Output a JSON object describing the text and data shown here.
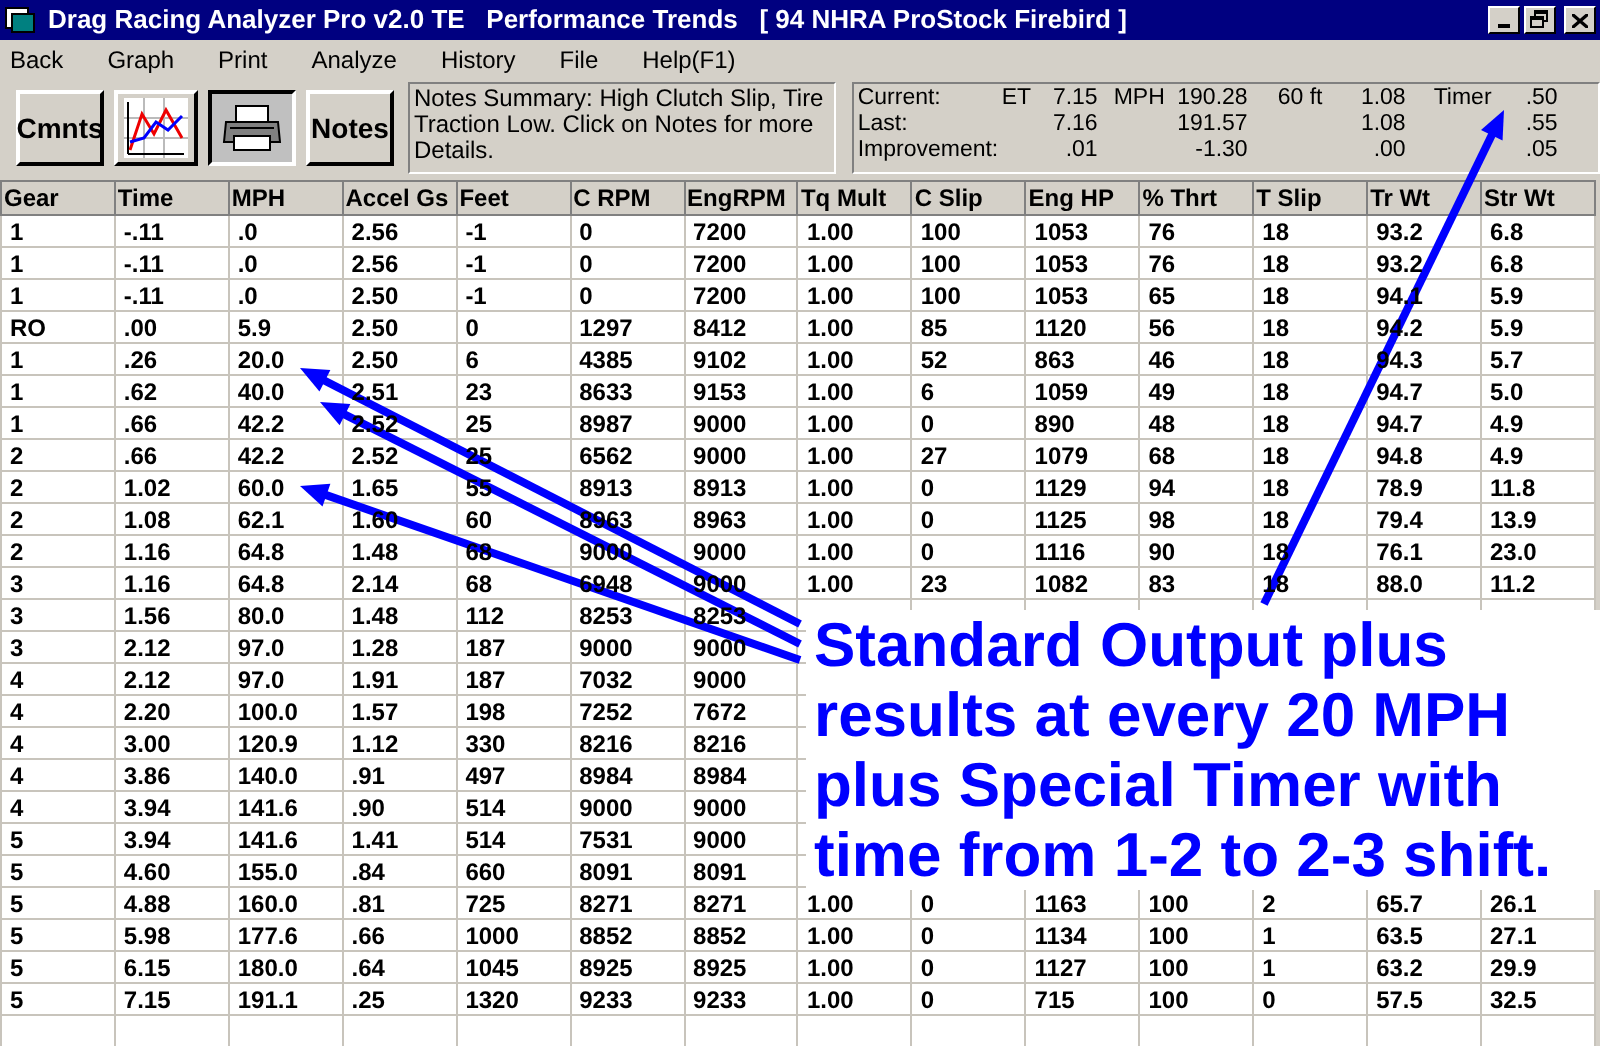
{
  "window": {
    "title": "Drag Racing Analyzer Pro v2.0 TE   Performance Trends   [ 94 NHRA ProStock Firebird ]"
  },
  "menu": [
    "Back",
    "Graph",
    "Print",
    "Analyze",
    "History",
    "File",
    "Help(F1)"
  ],
  "toolbar": [
    {
      "kind": "text",
      "label": "Cmnts"
    },
    {
      "kind": "graph"
    },
    {
      "kind": "print",
      "selected": true
    },
    {
      "kind": "text",
      "label": "Notes"
    }
  ],
  "notes_summary": "Notes Summary:   High Clutch Slip,  Tire Traction Low.  Click on Notes for more Details.",
  "stats": [
    {
      "label": "Current:",
      "et_label": "ET",
      "et": "7.15",
      "mph_label": "MPH",
      "mph": "190.28",
      "ft_label": "60 ft",
      "ft": "1.08",
      "timer_label": "Timer",
      "timer": ".50"
    },
    {
      "label": "Last:",
      "et": "7.16",
      "mph": "191.57",
      "ft": "1.08",
      "timer": ".55"
    },
    {
      "label": "Improvement:",
      "et": ".01",
      "mph": "-1.30",
      "ft": ".00",
      "timer": ".05"
    }
  ],
  "table": {
    "columns": [
      "Gear",
      "Time",
      "MPH",
      "Accel Gs",
      "Feet",
      "C RPM",
      "EngRPM",
      "Tq Mult",
      "C Slip",
      "Eng HP",
      "% Thrt",
      "T Slip",
      "Tr Wt",
      "Str Wt"
    ],
    "rows": [
      [
        "1",
        "-.11",
        ".0",
        "2.56",
        "-1",
        "0",
        "7200",
        "1.00",
        "100",
        "1053",
        "76",
        "18",
        "93.2",
        "6.8"
      ],
      [
        "1",
        "-.11",
        ".0",
        "2.56",
        "-1",
        "0",
        "7200",
        "1.00",
        "100",
        "1053",
        "76",
        "18",
        "93.2",
        "6.8"
      ],
      [
        "1",
        "-.11",
        ".0",
        "2.50",
        "-1",
        "0",
        "7200",
        "1.00",
        "100",
        "1053",
        "65",
        "18",
        "94.1",
        "5.9"
      ],
      [
        "RO",
        ".00",
        "5.9",
        "2.50",
        "0",
        "1297",
        "8412",
        "1.00",
        "85",
        "1120",
        "56",
        "18",
        "94.2",
        "5.9"
      ],
      [
        "1",
        ".26",
        "20.0",
        "2.50",
        "6",
        "4385",
        "9102",
        "1.00",
        "52",
        "863",
        "46",
        "18",
        "94.3",
        "5.7"
      ],
      [
        "1",
        ".62",
        "40.0",
        "2.51",
        "23",
        "8633",
        "9153",
        "1.00",
        "6",
        "1059",
        "49",
        "18",
        "94.7",
        "5.0"
      ],
      [
        "1",
        ".66",
        "42.2",
        "2.52",
        "25",
        "8987",
        "9000",
        "1.00",
        "0",
        "890",
        "48",
        "18",
        "94.7",
        "4.9"
      ],
      [
        "2",
        ".66",
        "42.2",
        "2.52",
        "25",
        "6562",
        "9000",
        "1.00",
        "27",
        "1079",
        "68",
        "18",
        "94.8",
        "4.9"
      ],
      [
        "2",
        "1.02",
        "60.0",
        "1.65",
        "55",
        "8913",
        "8913",
        "1.00",
        "0",
        "1129",
        "94",
        "18",
        "78.9",
        "11.8"
      ],
      [
        "2",
        "1.08",
        "62.1",
        "1.60",
        "60",
        "8963",
        "8963",
        "1.00",
        "0",
        "1125",
        "98",
        "18",
        "79.4",
        "13.9"
      ],
      [
        "2",
        "1.16",
        "64.8",
        "1.48",
        "68",
        "9000",
        "9000",
        "1.00",
        "0",
        "1116",
        "90",
        "18",
        "76.1",
        "23.0"
      ],
      [
        "3",
        "1.16",
        "64.8",
        "2.14",
        "68",
        "6948",
        "9000",
        "1.00",
        "23",
        "1082",
        "83",
        "18",
        "88.0",
        "11.2"
      ],
      [
        "3",
        "1.56",
        "80.0",
        "1.48",
        "112",
        "8253",
        "8253"
      ],
      [
        "3",
        "2.12",
        "97.0",
        "1.28",
        "187",
        "9000",
        "9000"
      ],
      [
        "4",
        "2.12",
        "97.0",
        "1.91",
        "187",
        "7032",
        "9000"
      ],
      [
        "4",
        "2.20",
        "100.0",
        "1.57",
        "198",
        "7252",
        "7672"
      ],
      [
        "4",
        "3.00",
        "120.9",
        "1.12",
        "330",
        "8216",
        "8216"
      ],
      [
        "4",
        "3.86",
        "140.0",
        ".91",
        "497",
        "8984",
        "8984"
      ],
      [
        "4",
        "3.94",
        "141.6",
        ".90",
        "514",
        "9000",
        "9000"
      ],
      [
        "5",
        "3.94",
        "141.6",
        "1.41",
        "514",
        "7531",
        "9000"
      ],
      [
        "5",
        "4.60",
        "155.0",
        ".84",
        "660",
        "8091",
        "8091"
      ],
      [
        "5",
        "4.88",
        "160.0",
        ".81",
        "725",
        "8271",
        "8271",
        "1.00",
        "0",
        "1163",
        "100",
        "2",
        "65.7",
        "26.1"
      ],
      [
        "5",
        "5.98",
        "177.6",
        ".66",
        "1000",
        "8852",
        "8852",
        "1.00",
        "0",
        "1134",
        "100",
        "1",
        "63.5",
        "27.1"
      ],
      [
        "5",
        "6.15",
        "180.0",
        ".64",
        "1045",
        "8925",
        "8925",
        "1.00",
        "0",
        "1127",
        "100",
        "1",
        "63.2",
        "29.9"
      ],
      [
        "5",
        "7.15",
        "191.1",
        ".25",
        "1320",
        "9233",
        "9233",
        "1.00",
        "0",
        "715",
        "100",
        "0",
        "57.5",
        "32.5"
      ]
    ]
  },
  "callout": "Standard Output plus results at every 20 MPH plus Special Timer with time from 1-2 to 2-3 shift."
}
